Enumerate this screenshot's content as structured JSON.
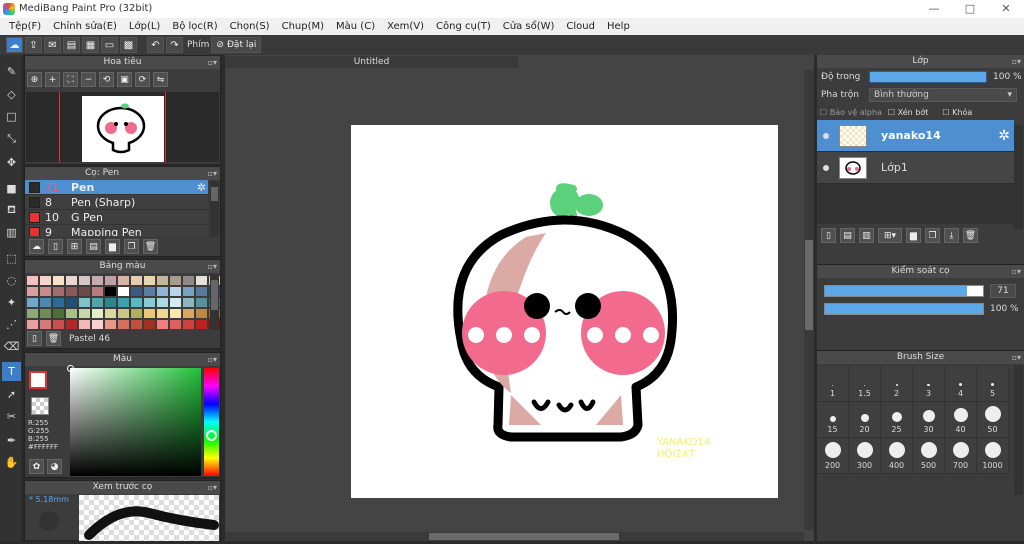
{
  "app_title": "MediBang Paint Pro (32bit)",
  "window_controls": [
    "—",
    "□",
    "✕"
  ],
  "menu": [
    "Tệp(F)",
    "Chỉnh sửa(E)",
    "Lớp(L)",
    "Bộ lọc(R)",
    "Chọn(S)",
    "Chup(M)",
    "Màu (C)",
    "Xem(V)",
    "Công cụ(T)",
    "Cửa sổ(W)",
    "Cloud",
    "Help"
  ],
  "toolbar": {
    "phim_label": "Phím",
    "reset_label": "Đặt lại"
  },
  "navigator": {
    "title": "Hoa tiêu"
  },
  "brush_panel": {
    "title": "Cọ: Pen",
    "items": [
      {
        "num": "71",
        "name": "Pen",
        "color": "#2b2b2b"
      },
      {
        "num": "8",
        "name": "Pen (Sharp)",
        "color": "#2b2b2b"
      },
      {
        "num": "10",
        "name": "G Pen",
        "color": "#e83232"
      },
      {
        "num": "9",
        "name": "Mapping Pen",
        "color": "#e83232"
      }
    ]
  },
  "palette_panel": {
    "title": "Bảng màu",
    "palette_name": "Pastel 46"
  },
  "color_panel": {
    "title": "Màu",
    "r": "R:255",
    "g": "G:255",
    "b": "B:255",
    "hex": "#FFFFFF"
  },
  "brush_preview": {
    "title": "Xem trước cọ",
    "size": "* 5.18mm"
  },
  "canvas": {
    "tab_title": "Untitled",
    "watermark_line1": "YANAKO14",
    "watermark_line2": "HỘI247"
  },
  "layer_panel": {
    "title": "Lớp",
    "opacity_label": "Độ trong",
    "opacity_value": "100 %",
    "opacity_fraction": 1.0,
    "blend_label": "Pha trộn",
    "blend_value": "Bình thường",
    "protect_alpha": "Bảo vệ alpha",
    "clipping": "Xén bớt",
    "lock": "Khóa",
    "layers": [
      {
        "name": "yanako14",
        "selected": true
      },
      {
        "name": "Lớp1",
        "selected": false
      }
    ]
  },
  "brush_control": {
    "title": "Kiểm soát cọ",
    "size_value": "71",
    "size_fraction": 0.9,
    "opacity_value": "100 %",
    "opacity_fraction": 1.0
  },
  "brush_size": {
    "title": "Brush Size",
    "sizes": [
      "1",
      "1.5",
      "2",
      "3",
      "4",
      "5",
      "15",
      "20",
      "25",
      "30",
      "40",
      "50",
      "200",
      "300",
      "400",
      "500",
      "700",
      "1000"
    ]
  },
  "colors": {
    "accent": "#4d8fd1",
    "pink_cheek": "#f26a8d",
    "sprout": "#5ad17a",
    "cheek_shadow": "#d9a9a4"
  }
}
